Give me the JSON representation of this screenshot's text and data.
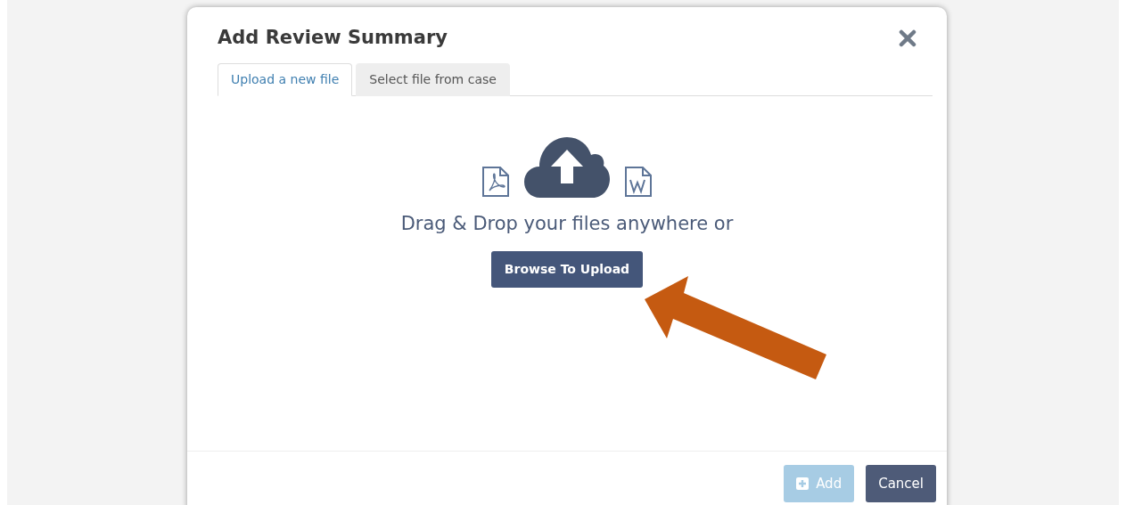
{
  "dialog": {
    "title": "Add Review Summary"
  },
  "tabs": [
    {
      "label": "Upload a new file",
      "selected": true
    },
    {
      "label": "Select file from case",
      "selected": false
    }
  ],
  "dropzone": {
    "text": "Drag & Drop your files anywhere or",
    "button": "Browse To Upload"
  },
  "footer_buttons": [
    {
      "label": "Add",
      "kind": "add",
      "disabled": true
    },
    {
      "label": "Cancel",
      "kind": "cancel",
      "disabled": false
    }
  ]
}
